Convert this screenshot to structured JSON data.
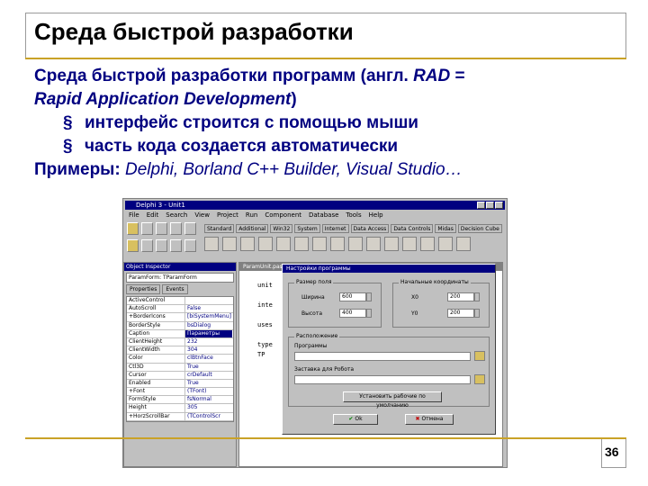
{
  "slide": {
    "title": "Среда быстрой разработки",
    "line1": "Среда быстрой разработки программ (англ. ",
    "line1_rad": "RAD",
    "line1_eq": " = ",
    "line2_italic": "Rapid Application Development",
    "line2_end": ")",
    "bullet_marker": "§",
    "bullets": [
      "интерфейс строится с помощью мыши",
      "часть кода создается автоматически"
    ],
    "examples_label": "Примеры:",
    "examples_value": " Delphi, Borland C++ Builder, Visual Studio…",
    "page_number": "36"
  },
  "ide": {
    "title": "Delphi 3 - Unit1",
    "menu": [
      "File",
      "Edit",
      "Search",
      "View",
      "Project",
      "Run",
      "Component",
      "Database",
      "Tools",
      "Help"
    ],
    "palette_tabs": [
      "Standard",
      "Additional",
      "Win32",
      "System",
      "Internet",
      "Data Access",
      "Data Controls",
      "Midas",
      "Decision Cube"
    ],
    "inspector_title": "Object Inspector",
    "inspector_combo": "ParamForm: TParamForm",
    "inspector_tabs": [
      "Properties",
      "Events"
    ],
    "inspector_rows": [
      {
        "k": "ActiveControl",
        "v": ""
      },
      {
        "k": "AutoScroll",
        "v": "False"
      },
      {
        "k": "+BorderIcons",
        "v": "[biSystemMenu]"
      },
      {
        "k": "BorderStyle",
        "v": "bsDialog"
      },
      {
        "k": "Caption",
        "v": "Параметры",
        "sel": true
      },
      {
        "k": "ClientHeight",
        "v": "232"
      },
      {
        "k": "ClientWidth",
        "v": "304"
      },
      {
        "k": "Color",
        "v": "clBtnFace"
      },
      {
        "k": "Ctl3D",
        "v": "True"
      },
      {
        "k": "Cursor",
        "v": "crDefault"
      },
      {
        "k": "Enabled",
        "v": "True"
      },
      {
        "k": "+Font",
        "v": "(TFont)"
      },
      {
        "k": "FormStyle",
        "v": "fsNormal"
      },
      {
        "k": "Height",
        "v": "305"
      },
      {
        "k": "+HorzScrollBar",
        "v": "(TControlScr"
      }
    ],
    "editor_title": "ParamUnit.pas",
    "editor_lines": [
      "unit",
      "",
      "inte",
      "",
      "uses",
      "",
      "type",
      "  TP"
    ],
    "dialog_title": "Настройки программы",
    "group1_label": "Размер поля",
    "group1_fields": [
      {
        "label": "Ширина",
        "value": "600"
      },
      {
        "label": "Высота",
        "value": "400"
      }
    ],
    "group2_label": "Начальные координаты",
    "group2_fields": [
      {
        "label": "X0",
        "value": "200"
      },
      {
        "label": "Y0",
        "value": "200"
      }
    ],
    "group3_label": "Расположение",
    "path1_label": "Программы",
    "path2_label": "Заставка для Робота",
    "default_button": "Установить рабочие по умолчанию",
    "ok_label": "Ok",
    "cancel_label": "Отмена"
  },
  "colors": {
    "title": "#000000",
    "body": "#000080",
    "accent_line": "#c9a227"
  }
}
